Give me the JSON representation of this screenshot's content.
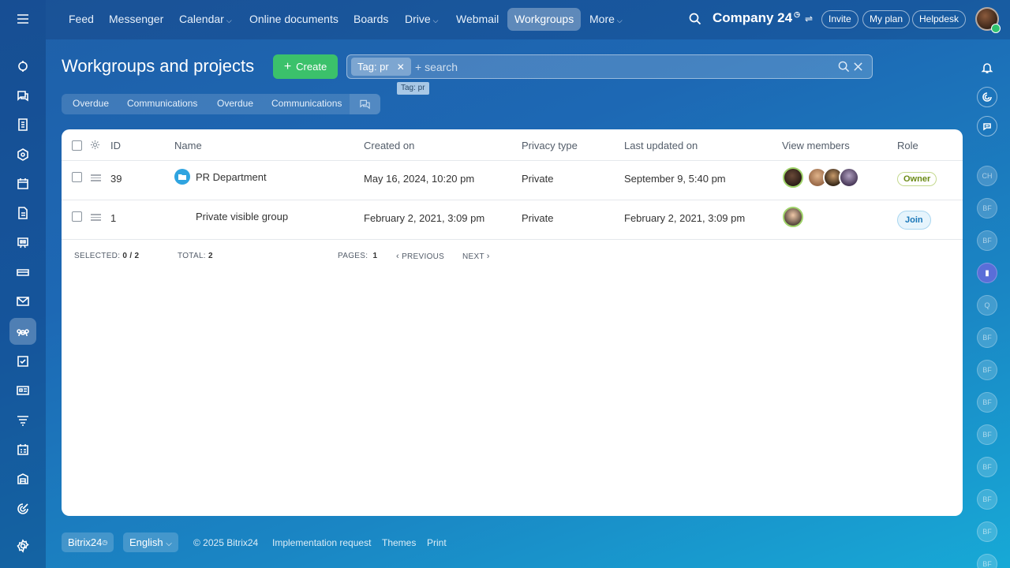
{
  "topbar": {
    "nav": [
      {
        "label": "Feed"
      },
      {
        "label": "Messenger"
      },
      {
        "label": "Calendar"
      },
      {
        "label": "Online documents"
      },
      {
        "label": "Boards"
      },
      {
        "label": "Drive"
      },
      {
        "label": "Webmail"
      },
      {
        "label": "Workgroups"
      },
      {
        "label": "More"
      }
    ],
    "company": "Company 24",
    "invite": "Invite",
    "my_plan": "My plan",
    "helpdesk": "Helpdesk"
  },
  "page": {
    "title": "Workgroups and projects",
    "create_label": "Create",
    "search_chip": "Tag: pr",
    "search_placeholder": "+ search",
    "tooltip": "Tag: pr"
  },
  "counters": [
    "Overdue",
    "Communications",
    "Overdue",
    "Communications"
  ],
  "grid": {
    "columns": [
      "ID",
      "Name",
      "Created on",
      "Privacy type",
      "Last updated on",
      "View members",
      "Role"
    ],
    "rows": [
      {
        "id": "39",
        "name": "PR Department",
        "created": "May 16, 2024, 10:20 pm",
        "privacy": "Private",
        "updated": "September 9, 5:40 pm",
        "role": "Owner"
      },
      {
        "id": "1",
        "name": "Private visible group",
        "created": "February 2, 2021, 3:09 pm",
        "privacy": "Private",
        "updated": "February 2, 2021, 3:09 pm",
        "role": "Join"
      }
    ],
    "footer": {
      "selected_label": "SELECTED:",
      "selected_value": "0 / 2",
      "total_label": "TOTAL:",
      "total_value": "2",
      "pages_label": "PAGES:",
      "pages_value": "1",
      "previous": "PREVIOUS",
      "next": "NEXT"
    }
  },
  "right_rail": {
    "chats": [
      "CH",
      "BF",
      "BF",
      "",
      "Q",
      "BF",
      "BF",
      "BF",
      "BF",
      "BF",
      "BF",
      "BF",
      "BF"
    ]
  },
  "footer": {
    "brand": "Bitrix24",
    "language": "English",
    "copyright": "© 2025 Bitrix24",
    "impl": "Implementation request",
    "themes": "Themes",
    "print": "Print"
  },
  "colors": {
    "accent_green": "#3bc16b",
    "owner_badge": "#6a8a15",
    "join_badge": "#1876b8"
  }
}
